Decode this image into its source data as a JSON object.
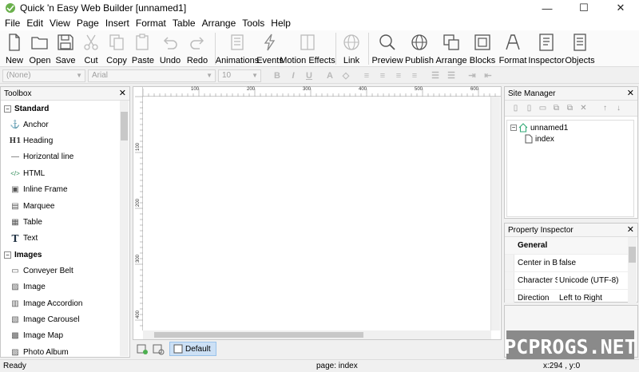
{
  "window": {
    "title": "Quick 'n Easy Web Builder [unnamed1]",
    "minimize": "—",
    "maximize": "☐",
    "close": "✕"
  },
  "menu": [
    "File",
    "Edit",
    "View",
    "Page",
    "Insert",
    "Format",
    "Table",
    "Arrange",
    "Tools",
    "Help"
  ],
  "toolbar": {
    "new": "New",
    "open": "Open",
    "save": "Save",
    "cut": "Cut",
    "copy": "Copy",
    "paste": "Paste",
    "undo": "Undo",
    "redo": "Redo",
    "animations": "Animations",
    "events": "Events",
    "motion_effects": "Motion Effects",
    "link": "Link",
    "preview": "Preview",
    "publish": "Publish",
    "arrange": "Arrange",
    "blocks": "Blocks",
    "format": "Format",
    "inspector": "Inspector",
    "objects": "Objects"
  },
  "formatbar": {
    "style": "(None)",
    "font": "Arial",
    "size": "10",
    "bold": "B",
    "italic": "I",
    "underline": "U"
  },
  "toolbox": {
    "title": "Toolbox",
    "close": "✕",
    "groups": [
      {
        "label": "Standard",
        "items": [
          {
            "label": "Anchor",
            "icon": "anchor-icon",
            "glyph": "⚓"
          },
          {
            "label": "Heading",
            "icon": "heading-icon",
            "glyph": "H1"
          },
          {
            "label": "Horizontal line",
            "icon": "horizontal-line-icon",
            "glyph": "—"
          },
          {
            "label": "HTML",
            "icon": "html-icon",
            "glyph": "</>"
          },
          {
            "label": "Inline Frame",
            "icon": "inline-frame-icon",
            "glyph": "▣"
          },
          {
            "label": "Marquee",
            "icon": "marquee-icon",
            "glyph": "▤"
          },
          {
            "label": "Table",
            "icon": "table-icon",
            "glyph": "▦"
          },
          {
            "label": "Text",
            "icon": "text-icon",
            "glyph": "T"
          }
        ]
      },
      {
        "label": "Images",
        "items": [
          {
            "label": "Conveyer Belt",
            "icon": "conveyer-belt-icon",
            "glyph": "▭"
          },
          {
            "label": "Image",
            "icon": "image-icon",
            "glyph": "▨"
          },
          {
            "label": "Image Accordion",
            "icon": "image-accordion-icon",
            "glyph": "▥"
          },
          {
            "label": "Image Carousel",
            "icon": "image-carousel-icon",
            "glyph": "▧"
          },
          {
            "label": "Image Map",
            "icon": "image-map-icon",
            "glyph": "▩"
          },
          {
            "label": "Photo Album",
            "icon": "photo-album-icon",
            "glyph": "▨"
          }
        ]
      }
    ]
  },
  "ruler": {
    "top": [
      "100",
      "200",
      "300",
      "400",
      "500",
      "600"
    ],
    "left": [
      "100",
      "200",
      "300",
      "400"
    ]
  },
  "page_tab": {
    "label": "Default"
  },
  "site_manager": {
    "title": "Site Manager",
    "close": "✕",
    "tree": {
      "root": "unnamed1",
      "child": "index"
    }
  },
  "property_inspector": {
    "title": "Property Inspector",
    "close": "✕",
    "group": "General",
    "rows": [
      {
        "key": "Center in Br",
        "value": "false"
      },
      {
        "key": "Character S",
        "value": "Unicode (UTF-8)"
      },
      {
        "key": "Direction",
        "value": "Left to Right"
      }
    ]
  },
  "watermark": "PCPROGS.NET",
  "status": {
    "left": "Ready",
    "middle": "page: index",
    "right": "x:294 , y:0"
  }
}
